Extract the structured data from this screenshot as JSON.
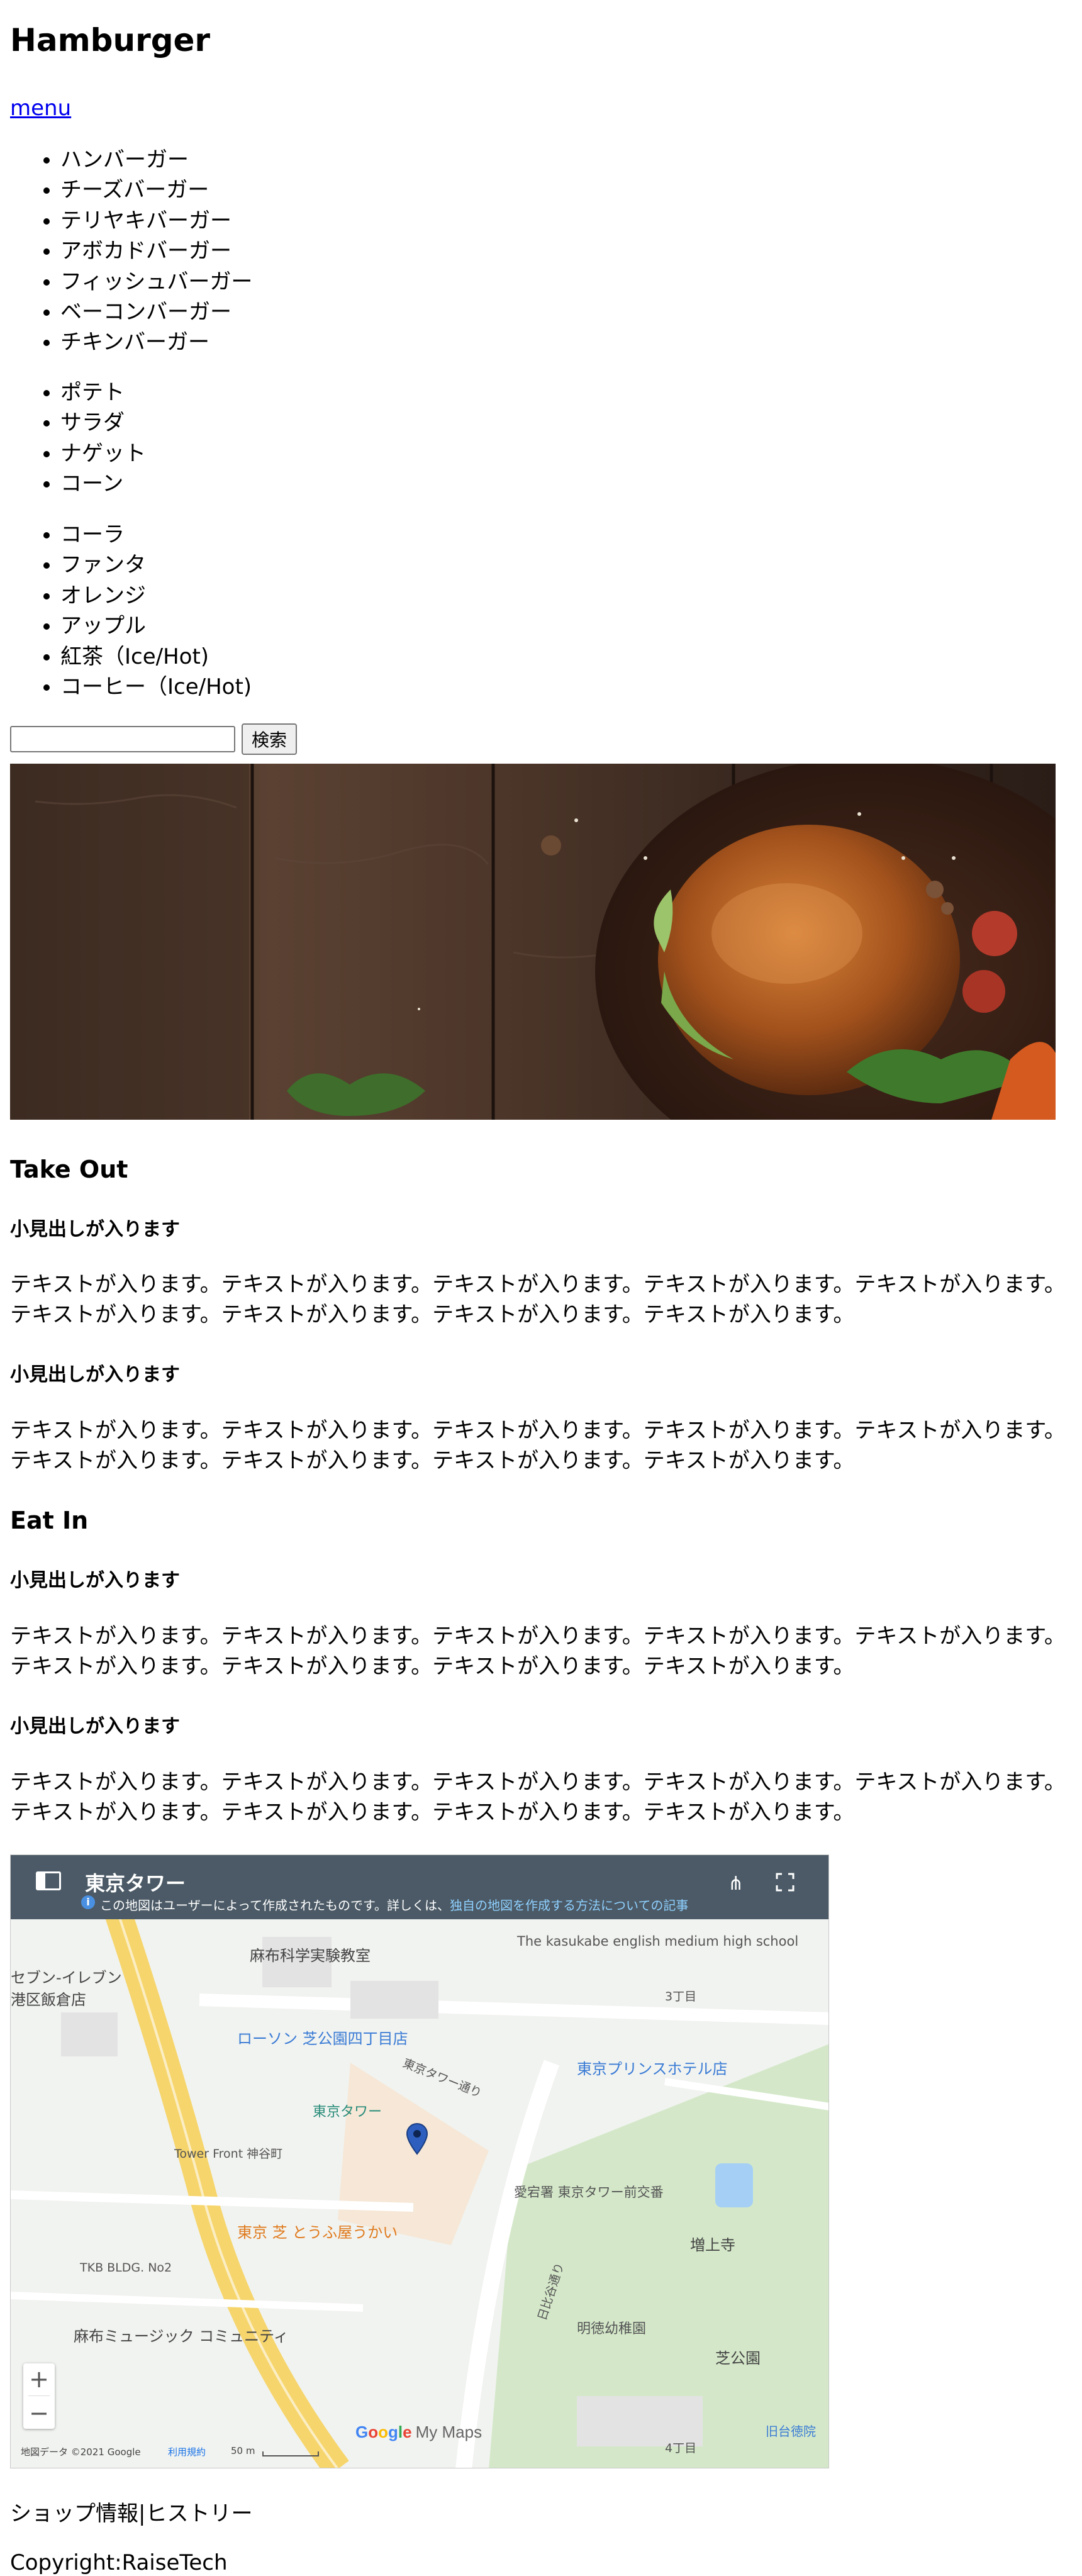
{
  "header": {
    "title": "Hamburger",
    "menu_link": "menu"
  },
  "menu": {
    "burgers": [
      "ハンバーガー",
      "チーズバーガー",
      "テリヤキバーガー",
      "アボカドバーガー",
      "フィッシュバーガー",
      "ベーコンバーガー",
      "チキンバーガー"
    ],
    "sides": [
      "ポテト",
      "サラダ",
      "ナゲット",
      "コーン"
    ],
    "drinks": [
      "コーラ",
      "ファンタ",
      "オレンジ",
      "アップル",
      "紅茶（Ice/Hot)",
      "コーヒー（Ice/Hot)"
    ]
  },
  "search": {
    "value": "",
    "button_label": "検索"
  },
  "takeout": {
    "title": "Take Out",
    "subtitle_1": "小見出しが入ります",
    "text_1": "テキストが入ります。テキストが入ります。テキストが入ります。テキストが入ります。テキストが入ります。テキストが入ります。テキストが入ります。テキストが入ります。テキストが入ります。",
    "subtitle_2": "小見出しが入ります",
    "text_2": "テキストが入ります。テキストが入ります。テキストが入ります。テキストが入ります。テキストが入ります。テキストが入ります。テキストが入ります。テキストが入ります。テキストが入ります。"
  },
  "eatin": {
    "title": "Eat In",
    "subtitle_1": "小見出しが入ります",
    "text_1": "テキストが入ります。テキストが入ります。テキストが入ります。テキストが入ります。テキストが入ります。テキストが入ります。テキストが入ります。テキストが入ります。テキストが入ります。",
    "subtitle_2": "小見出しが入ります",
    "text_2": "テキストが入ります。テキストが入ります。テキストが入ります。テキストが入ります。テキストが入ります。テキストが入ります。テキストが入ります。テキストが入ります。テキストが入ります。"
  },
  "map": {
    "title": "東京タワー",
    "notice_text": "この地図はユーザーによって作成されたものです。詳しくは、",
    "notice_link": "独自の地図を作成する方法についての記事",
    "attribution": "地図データ ©2021 Google",
    "terms": "利用規約",
    "scale": "50 m",
    "brand_g1": "G",
    "brand_o1": "o",
    "brand_o2": "o",
    "brand_g2": "g",
    "brand_l": "l",
    "brand_e": "e",
    "brand_mymaps": "My Maps",
    "labels": {
      "shiba_koen": "芝公園",
      "tokyo_tower": "東京タワー",
      "tofuya": "東京 芝 とうふ屋うかい",
      "lawson": "ローソン 芝公園四丁目店",
      "prince_hotel": "東京プリンスホテル店",
      "zojoji": "増上寺",
      "azabu_science": "麻布科学実験教室",
      "minato_library": "港区飯倉店",
      "kasukabe_school": "The kasukabe english medium high school",
      "tower_front": "Tower Front 神谷町",
      "hibiya_dori": "日比谷通り",
      "tokyo_tower_dori": "東京タワー通り",
      "tkb_building": "TKB BLDG. No2",
      "azabu_museum": "麻布ミュージック コミュニティ",
      "atago_school": "愛宕署 東京タワー前交番",
      "meitoku": "明徳幼稚園",
      "seven_eleven": "セブン-イレブン",
      "shiba_temple": "旧台徳院",
      "chome_3": "3丁目",
      "chome_4": "4丁目"
    },
    "zoom_in": "+",
    "zoom_out": "−",
    "share_icon": "⋔"
  },
  "footer": {
    "nav_shop": "ショップ情報",
    "nav_separator": "|",
    "nav_history": "ヒストリー",
    "copyright": "Copyright:RaiseTech"
  }
}
